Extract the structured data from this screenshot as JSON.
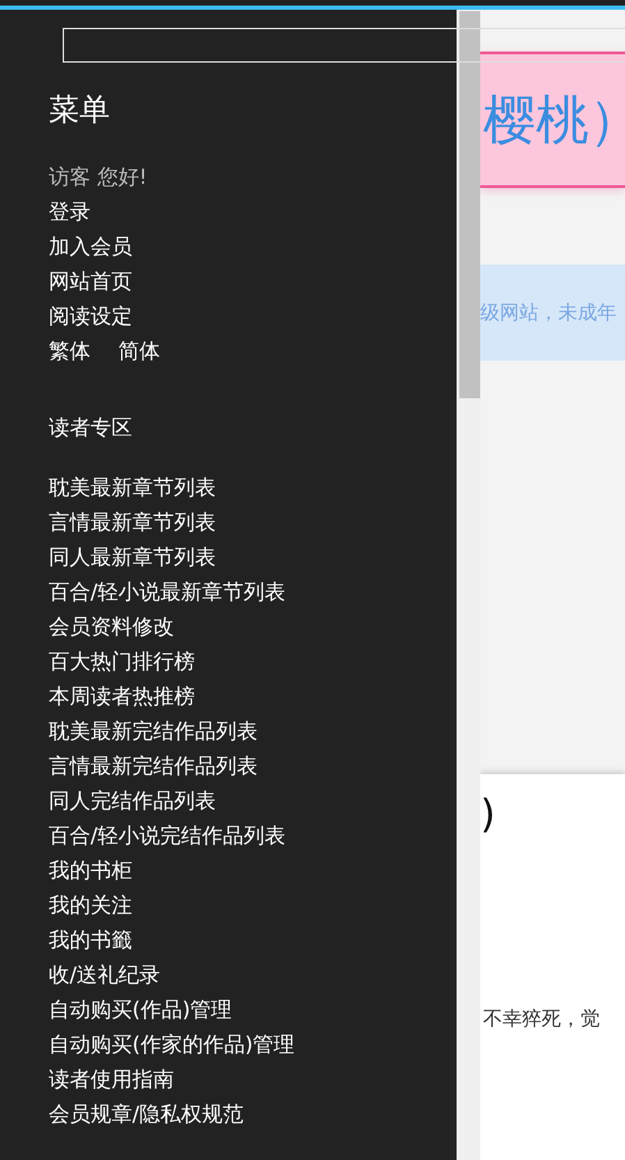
{
  "menu": {
    "title": "菜单",
    "greeting": "访客 您好!",
    "account_links": [
      "登录",
      "加入会员",
      "网站首页",
      "阅读设定"
    ],
    "script_options": [
      "繁体",
      "简体"
    ],
    "section_title": "读者专区",
    "section_links": [
      "耽美最新章节列表",
      "言情最新章节列表",
      "同人最新章节列表",
      "百合/轻小说最新章节列表",
      "会员资料修改",
      "百大热门排行榜",
      "本周读者热推榜",
      "耽美最新完结作品列表",
      "言情最新完结作品列表",
      "同人完结作品列表",
      "百合/轻小说完结作品列表",
      "我的书柜",
      "我的关注",
      "我的书籤",
      "收/送礼纪录",
      "自动购买(作品)管理",
      "自动购买(作家的作品)管理",
      "读者使用指南",
      "会员规章/隐私权规范"
    ]
  },
  "page": {
    "banner_title": "樱桃）",
    "notice": "级网站，未成年",
    "heading": ")",
    "body_text": "不幸猝死，觉"
  }
}
